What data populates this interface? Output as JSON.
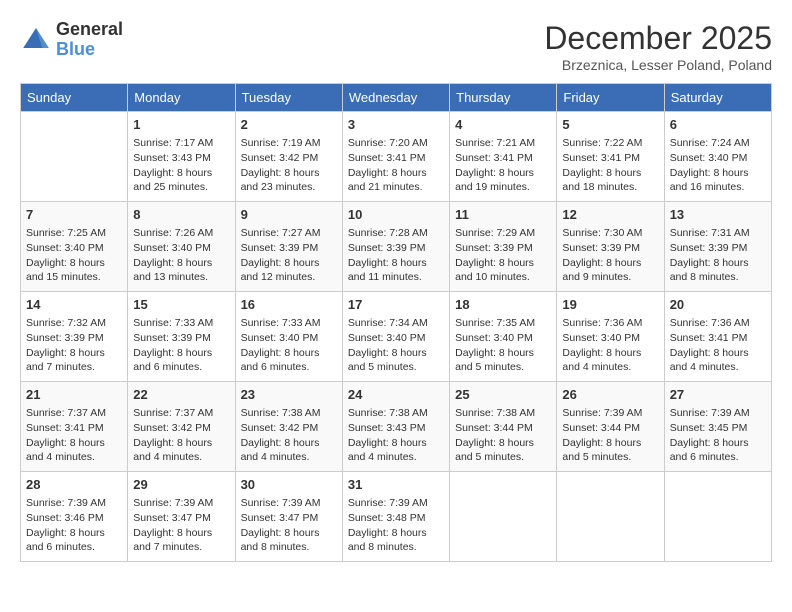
{
  "logo": {
    "general": "General",
    "blue": "Blue"
  },
  "title": "December 2025",
  "subtitle": "Brzeznica, Lesser Poland, Poland",
  "days_header": [
    "Sunday",
    "Monday",
    "Tuesday",
    "Wednesday",
    "Thursday",
    "Friday",
    "Saturday"
  ],
  "weeks": [
    [
      {
        "day": "",
        "info": ""
      },
      {
        "day": "1",
        "info": "Sunrise: 7:17 AM\nSunset: 3:43 PM\nDaylight: 8 hours\nand 25 minutes."
      },
      {
        "day": "2",
        "info": "Sunrise: 7:19 AM\nSunset: 3:42 PM\nDaylight: 8 hours\nand 23 minutes."
      },
      {
        "day": "3",
        "info": "Sunrise: 7:20 AM\nSunset: 3:41 PM\nDaylight: 8 hours\nand 21 minutes."
      },
      {
        "day": "4",
        "info": "Sunrise: 7:21 AM\nSunset: 3:41 PM\nDaylight: 8 hours\nand 19 minutes."
      },
      {
        "day": "5",
        "info": "Sunrise: 7:22 AM\nSunset: 3:41 PM\nDaylight: 8 hours\nand 18 minutes."
      },
      {
        "day": "6",
        "info": "Sunrise: 7:24 AM\nSunset: 3:40 PM\nDaylight: 8 hours\nand 16 minutes."
      }
    ],
    [
      {
        "day": "7",
        "info": "Sunrise: 7:25 AM\nSunset: 3:40 PM\nDaylight: 8 hours\nand 15 minutes."
      },
      {
        "day": "8",
        "info": "Sunrise: 7:26 AM\nSunset: 3:40 PM\nDaylight: 8 hours\nand 13 minutes."
      },
      {
        "day": "9",
        "info": "Sunrise: 7:27 AM\nSunset: 3:39 PM\nDaylight: 8 hours\nand 12 minutes."
      },
      {
        "day": "10",
        "info": "Sunrise: 7:28 AM\nSunset: 3:39 PM\nDaylight: 8 hours\nand 11 minutes."
      },
      {
        "day": "11",
        "info": "Sunrise: 7:29 AM\nSunset: 3:39 PM\nDaylight: 8 hours\nand 10 minutes."
      },
      {
        "day": "12",
        "info": "Sunrise: 7:30 AM\nSunset: 3:39 PM\nDaylight: 8 hours\nand 9 minutes."
      },
      {
        "day": "13",
        "info": "Sunrise: 7:31 AM\nSunset: 3:39 PM\nDaylight: 8 hours\nand 8 minutes."
      }
    ],
    [
      {
        "day": "14",
        "info": "Sunrise: 7:32 AM\nSunset: 3:39 PM\nDaylight: 8 hours\nand 7 minutes."
      },
      {
        "day": "15",
        "info": "Sunrise: 7:33 AM\nSunset: 3:39 PM\nDaylight: 8 hours\nand 6 minutes."
      },
      {
        "day": "16",
        "info": "Sunrise: 7:33 AM\nSunset: 3:40 PM\nDaylight: 8 hours\nand 6 minutes."
      },
      {
        "day": "17",
        "info": "Sunrise: 7:34 AM\nSunset: 3:40 PM\nDaylight: 8 hours\nand 5 minutes."
      },
      {
        "day": "18",
        "info": "Sunrise: 7:35 AM\nSunset: 3:40 PM\nDaylight: 8 hours\nand 5 minutes."
      },
      {
        "day": "19",
        "info": "Sunrise: 7:36 AM\nSunset: 3:40 PM\nDaylight: 8 hours\nand 4 minutes."
      },
      {
        "day": "20",
        "info": "Sunrise: 7:36 AM\nSunset: 3:41 PM\nDaylight: 8 hours\nand 4 minutes."
      }
    ],
    [
      {
        "day": "21",
        "info": "Sunrise: 7:37 AM\nSunset: 3:41 PM\nDaylight: 8 hours\nand 4 minutes."
      },
      {
        "day": "22",
        "info": "Sunrise: 7:37 AM\nSunset: 3:42 PM\nDaylight: 8 hours\nand 4 minutes."
      },
      {
        "day": "23",
        "info": "Sunrise: 7:38 AM\nSunset: 3:42 PM\nDaylight: 8 hours\nand 4 minutes."
      },
      {
        "day": "24",
        "info": "Sunrise: 7:38 AM\nSunset: 3:43 PM\nDaylight: 8 hours\nand 4 minutes."
      },
      {
        "day": "25",
        "info": "Sunrise: 7:38 AM\nSunset: 3:44 PM\nDaylight: 8 hours\nand 5 minutes."
      },
      {
        "day": "26",
        "info": "Sunrise: 7:39 AM\nSunset: 3:44 PM\nDaylight: 8 hours\nand 5 minutes."
      },
      {
        "day": "27",
        "info": "Sunrise: 7:39 AM\nSunset: 3:45 PM\nDaylight: 8 hours\nand 6 minutes."
      }
    ],
    [
      {
        "day": "28",
        "info": "Sunrise: 7:39 AM\nSunset: 3:46 PM\nDaylight: 8 hours\nand 6 minutes."
      },
      {
        "day": "29",
        "info": "Sunrise: 7:39 AM\nSunset: 3:47 PM\nDaylight: 8 hours\nand 7 minutes."
      },
      {
        "day": "30",
        "info": "Sunrise: 7:39 AM\nSunset: 3:47 PM\nDaylight: 8 hours\nand 8 minutes."
      },
      {
        "day": "31",
        "info": "Sunrise: 7:39 AM\nSunset: 3:48 PM\nDaylight: 8 hours\nand 8 minutes."
      },
      {
        "day": "",
        "info": ""
      },
      {
        "day": "",
        "info": ""
      },
      {
        "day": "",
        "info": ""
      }
    ]
  ]
}
